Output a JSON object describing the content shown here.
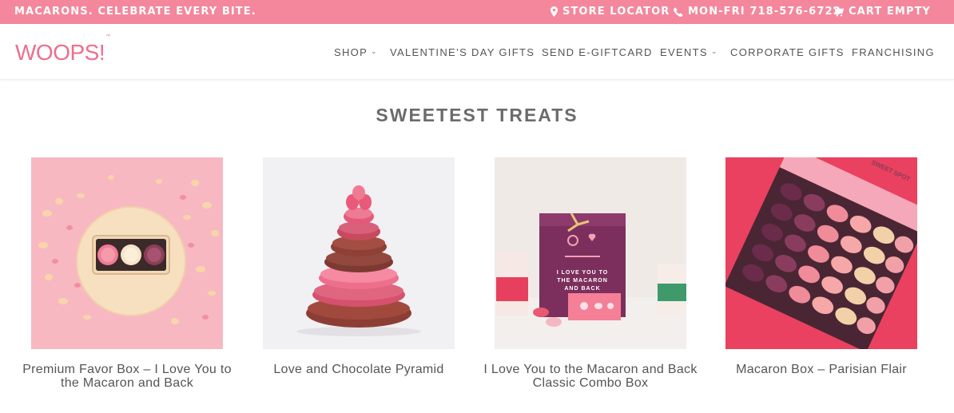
{
  "topbar": {
    "tagline": "MACARONS. CELEBRATE EVERY BITE.",
    "store_locator": "STORE LOCATOR",
    "phone": "MON-FRI 718-576-6722",
    "cart": "CART EMPTY",
    "icons": [
      "map-marker-icon",
      "phone-icon",
      "cart-icon"
    ]
  },
  "header": {
    "logo": "WOOPS!",
    "logo_tm": "™",
    "nav": [
      {
        "label": "SHOP",
        "has_dropdown": true
      },
      {
        "label": "VALENTINE’S DAY GIFTS",
        "has_dropdown": false
      },
      {
        "label": "SEND E-GIFTCARD",
        "has_dropdown": false
      },
      {
        "label": "EVENTS",
        "has_dropdown": true
      },
      {
        "label": "CORPORATE GIFTS",
        "has_dropdown": false
      },
      {
        "label": "FRANCHISING",
        "has_dropdown": false
      }
    ],
    "dropdown_glyph": "⌄"
  },
  "main": {
    "section_title": "SWEETEST TREATS",
    "products": [
      {
        "title": "Premium Favor Box – I Love You to the Macaron and Back"
      },
      {
        "title": "Love and Chocolate Pyramid"
      },
      {
        "title": "I Love You to the Macaron and Back Classic Combo Box"
      },
      {
        "title": "Macaron Box – Parisian Flair"
      }
    ],
    "image_text": {
      "box_message": "I LOVE YOU TO THE MACARON AND BACK",
      "box_lid": "SWEET SPOT"
    }
  },
  "colors": {
    "brand_pink": "#f4879c",
    "logo_pink": "#ec6f8e",
    "text_gray": "#555555",
    "title_gray": "#6b6b6b"
  }
}
